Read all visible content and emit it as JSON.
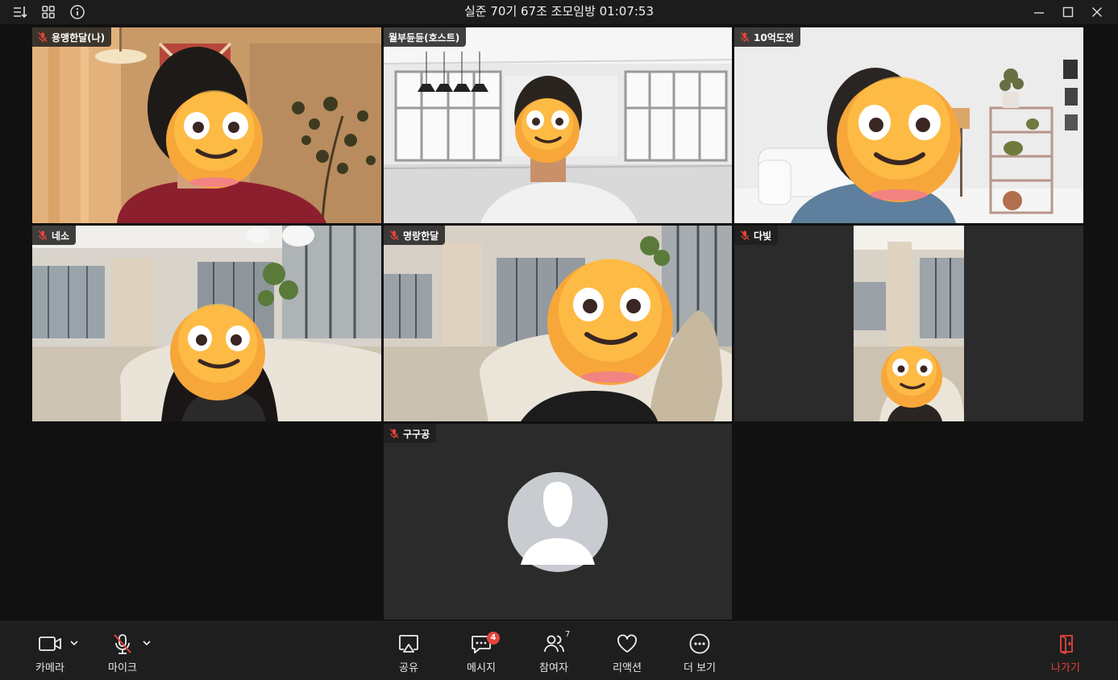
{
  "window": {
    "title": "실준 70기 67조 조모임방 01:07:53"
  },
  "participants": [
    {
      "name": "용맹한달(나)",
      "muted": true
    },
    {
      "name": "월부듄듄(호스트)",
      "muted": false
    },
    {
      "name": "10억도전",
      "muted": true
    },
    {
      "name": "네소",
      "muted": true
    },
    {
      "name": "명랑한달",
      "muted": true
    },
    {
      "name": "다빛",
      "muted": true
    },
    {
      "name": "구구공",
      "muted": true
    }
  ],
  "toolbar": {
    "camera_label": "카메라",
    "mic_label": "마이크",
    "share_label": "공유",
    "messages_label": "메시지",
    "messages_badge": "4",
    "participants_label": "참여자",
    "participants_count": "7",
    "reaction_label": "리액션",
    "more_label": "더 보기",
    "leave_label": "나가기"
  },
  "colors": {
    "accent_red": "#e5443b",
    "tile_empty": "#2b2b2b",
    "background": "#111111"
  }
}
